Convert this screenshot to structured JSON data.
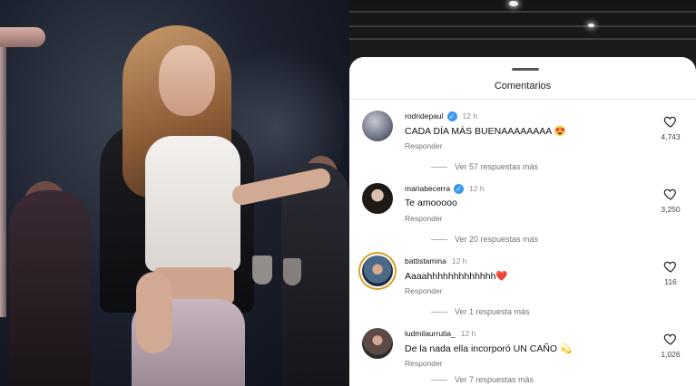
{
  "sheet": {
    "title": "Comentarios"
  },
  "comments": [
    {
      "username": "rodridepaul",
      "verified": true,
      "time": "12 h",
      "text": "CADA DÍA MÁS BUENAAAAAAAA 😍",
      "reply_label": "Responder",
      "likes": "4,743",
      "more_replies": "Ver 57 respuestas más"
    },
    {
      "username": "mariabecerra",
      "verified": true,
      "time": "12 h",
      "text": "Te amooooo",
      "reply_label": "Responder",
      "likes": "3,250",
      "more_replies": "Ver 20 respuestas más"
    },
    {
      "username": "battistamina",
      "verified": false,
      "time": "12 h",
      "text": "Aaaahhhhhhhhhhhhh❤️",
      "reply_label": "Responder",
      "likes": "116",
      "more_replies": "Ver 1 respuesta más"
    },
    {
      "username": "ludmilaurrutia_",
      "verified": false,
      "time": "12 h",
      "text": "De la nada ella incorporó UN CAÑO 💫",
      "reply_label": "Responder",
      "likes": "1,026",
      "more_replies": "Ver 7 respuestas más"
    }
  ],
  "icons": {
    "verified": "verified-badge-icon",
    "like": "heart-outline-icon"
  },
  "colors": {
    "verified": "#3897f0",
    "story_ring": "#d6a02a"
  }
}
